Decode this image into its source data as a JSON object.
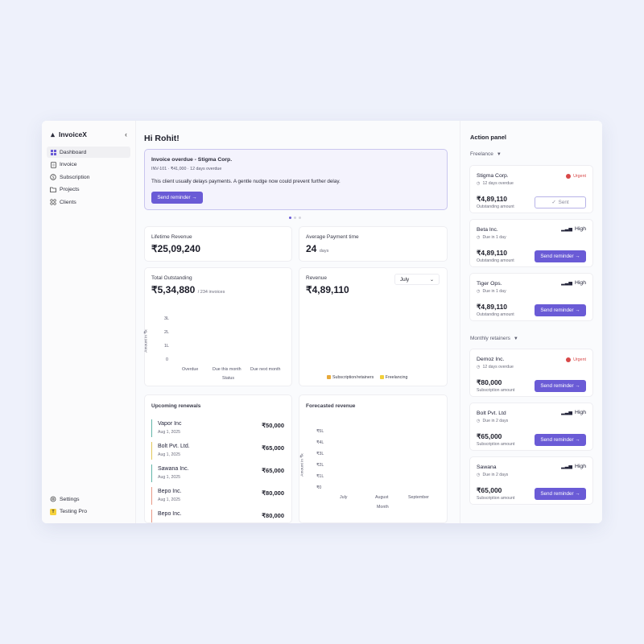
{
  "app": {
    "name": "InvoiceX"
  },
  "nav": {
    "items": [
      {
        "label": "Dashboard"
      },
      {
        "label": "Invoice"
      },
      {
        "label": "Subscription"
      },
      {
        "label": "Projects"
      },
      {
        "label": "Clients"
      }
    ],
    "settings": "Settings",
    "workspace": "Testing Pro",
    "workspace_initial": "T"
  },
  "greeting": "Hi Rohit!",
  "alert": {
    "title": "Invoice overdue - Stigma Corp.",
    "meta": "INV-101 · ₹41,000 · 12 days overdue",
    "message": "This client usually delays payments. A gentle nudge now could prevent further delay.",
    "button": "Send reminder →"
  },
  "stats": {
    "lifetime_revenue": {
      "label": "Lifetime Revenue",
      "value": "₹25,09,240"
    },
    "avg_payment_time": {
      "label": "Average Payment time",
      "value": "24",
      "unit": "days"
    }
  },
  "outstanding": {
    "label": "Total Outstanding",
    "value": "₹5,34,880",
    "sub": "/ 234 invoices",
    "chart_data": {
      "type": "bar",
      "categories": [
        "Overdue",
        "Due this month",
        "Due next month"
      ],
      "values": [
        0,
        0,
        0
      ],
      "xlabel": "Status",
      "ylabel": "Amount in ₹k",
      "yticks": [
        "3L",
        "2L",
        "1L",
        "0"
      ]
    }
  },
  "revenue": {
    "label": "Revenue",
    "value": "₹4,89,110",
    "month": "July",
    "legend": [
      {
        "name": "Subscription/retainers",
        "color": "#e7a93a"
      },
      {
        "name": "Freelancing",
        "color": "#f1cf3a"
      }
    ]
  },
  "renewals": {
    "title": "Upcoming renewals",
    "items": [
      {
        "name": "Vapor Inc",
        "date": "Aug 1, 2025",
        "amount": "₹50,000",
        "color": "#62b5a8"
      },
      {
        "name": "Bolt Pvt. Ltd.",
        "date": "Aug 1, 2025",
        "amount": "₹65,000",
        "color": "#e3c85a"
      },
      {
        "name": "Sawana Inc.",
        "date": "Aug 1, 2025",
        "amount": "₹65,000",
        "color": "#62b5a8"
      },
      {
        "name": "Bepo Inc.",
        "date": "Aug 1, 2025",
        "amount": "₹80,000",
        "color": "#e89a88"
      },
      {
        "name": "Bepo Inc.",
        "date": "",
        "amount": "₹80,000",
        "color": "#e89a88"
      }
    ]
  },
  "forecast": {
    "title": "Forecasted revenue",
    "chart_data": {
      "type": "bar",
      "categories": [
        "July",
        "August",
        "September"
      ],
      "values": [
        0,
        0,
        0
      ],
      "xlabel": "Month",
      "ylabel": "Amount in ₹k",
      "yticks": [
        "₹5L",
        "₹4L",
        "₹3L",
        "₹2L",
        "₹1L",
        "₹0"
      ]
    }
  },
  "action_panel": {
    "title": "Action panel",
    "groups": [
      {
        "name": "Freelance",
        "items": [
          {
            "client": "Stigma Corp.",
            "due": "12 days overdue",
            "priority": "Urgent",
            "amount": "₹4,89,110",
            "amount_label": "Outstanding amount",
            "button": "Sent",
            "sent": true
          },
          {
            "client": "Beta Inc.",
            "due": "Due in 1 day",
            "priority": "High",
            "amount": "₹4,89,110",
            "amount_label": "Outstanding amount",
            "button": "Send reminder →",
            "sent": false
          },
          {
            "client": "Tiger Ops.",
            "due": "Due in 1 day",
            "priority": "High",
            "amount": "₹4,89,110",
            "amount_label": "Outstanding amount",
            "button": "Send reminder →",
            "sent": false
          }
        ]
      },
      {
        "name": "Monthly retainers",
        "items": [
          {
            "client": "Demoz Inc.",
            "due": "12 days overdue",
            "priority": "Urgent",
            "amount": "₹80,000",
            "amount_label": "Subscription amount",
            "button": "Send reminder →",
            "sent": false
          },
          {
            "client": "Bolt Pvt. Ltd",
            "due": "Due in 2 days",
            "priority": "High",
            "amount": "₹65,000",
            "amount_label": "Subscription amount",
            "button": "Send reminder →",
            "sent": false
          },
          {
            "client": "Sawana",
            "due": "Due in 2 days",
            "priority": "High",
            "amount": "₹65,000",
            "amount_label": "Subscription amount",
            "button": "Send reminder →",
            "sent": false
          }
        ]
      }
    ]
  },
  "colors": {
    "accent": "#6a5bd6",
    "urgent": "#d84848"
  }
}
